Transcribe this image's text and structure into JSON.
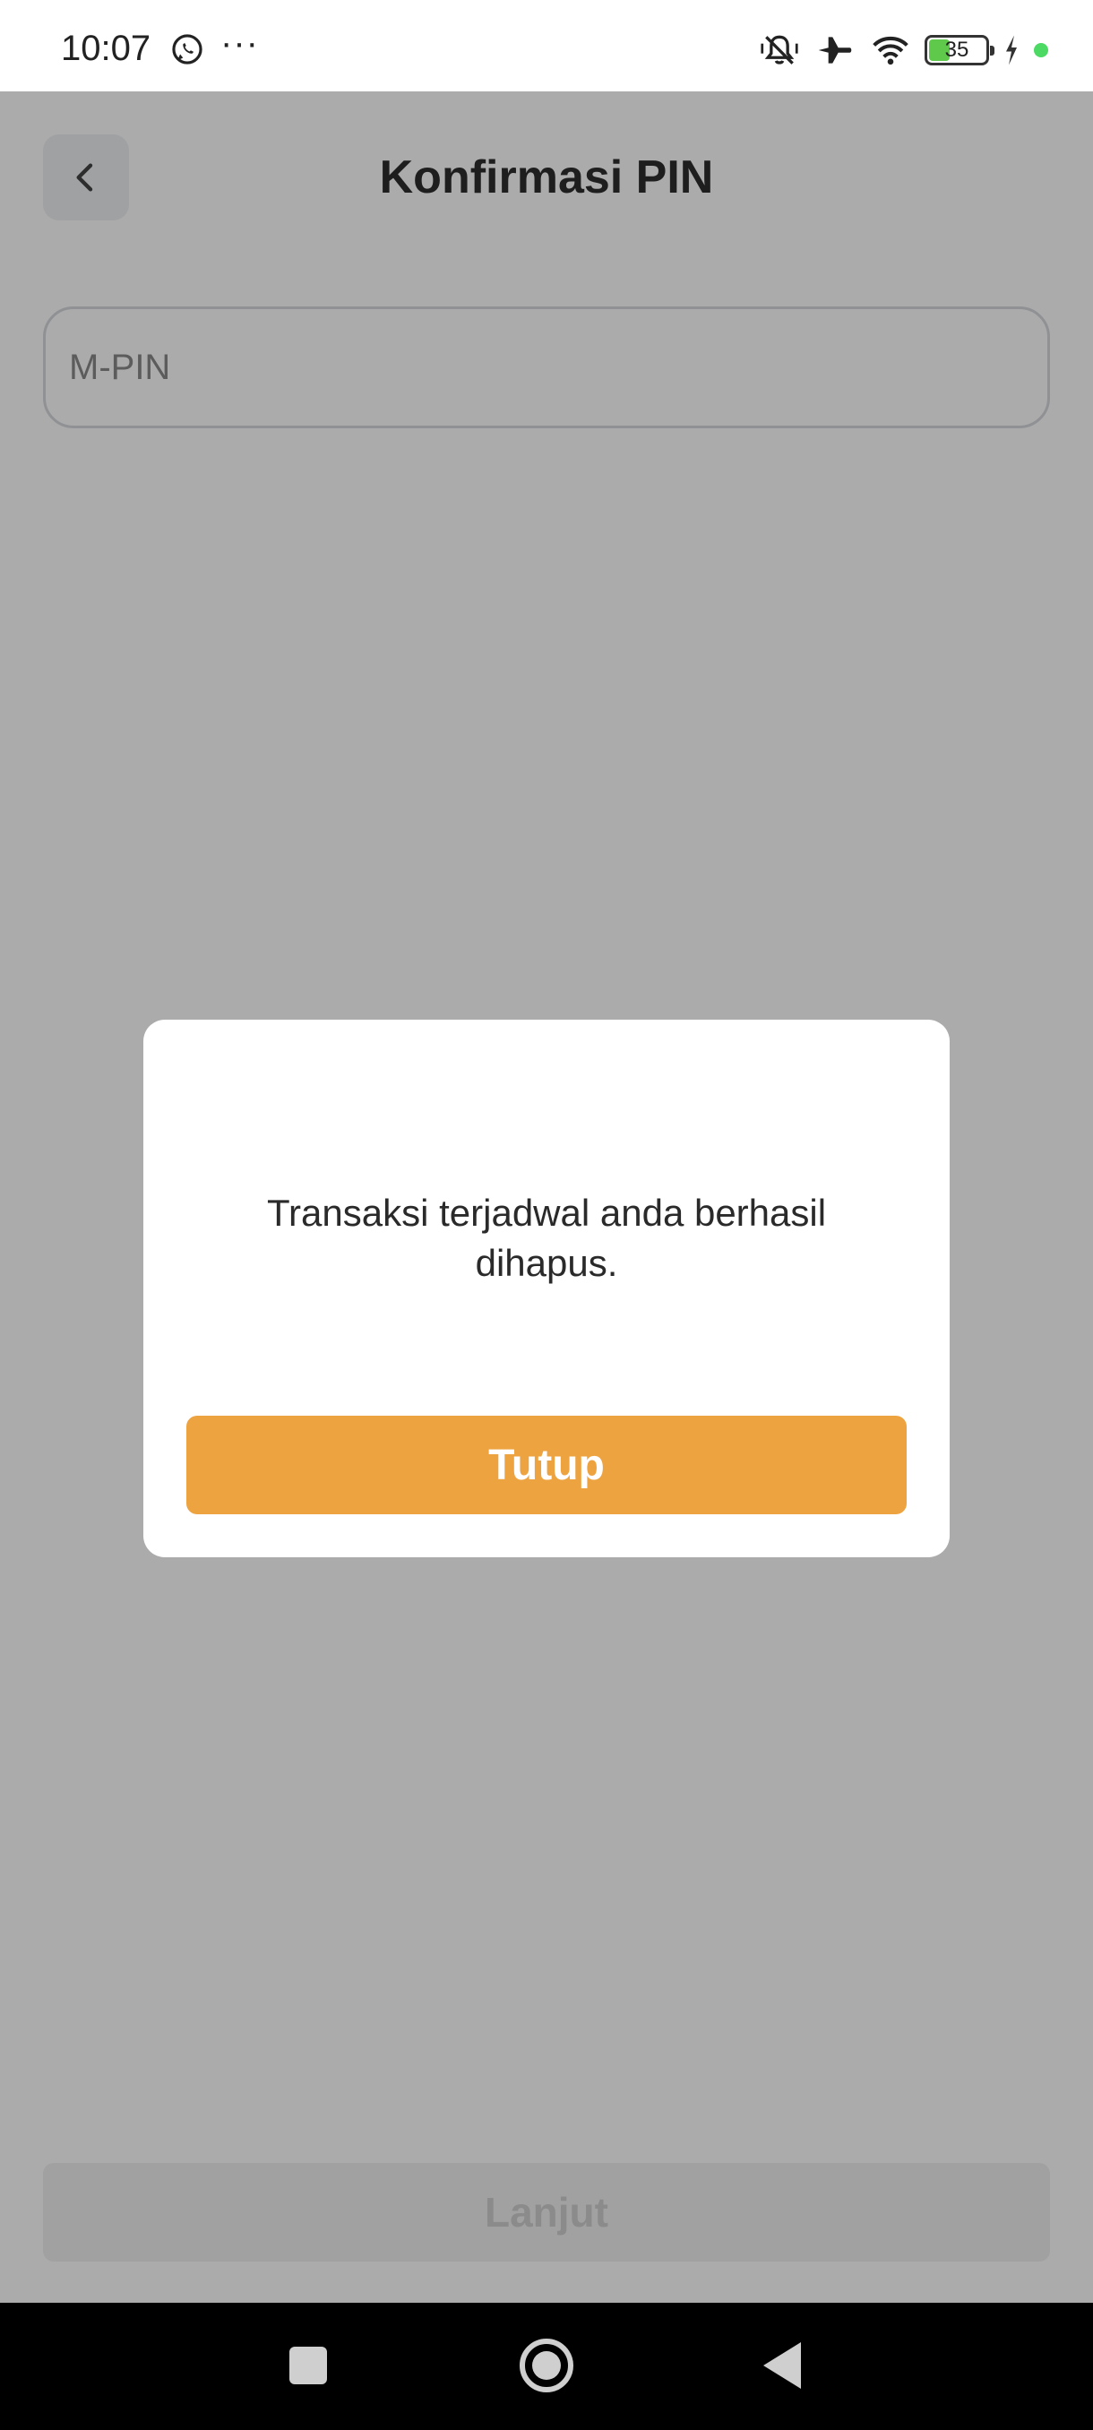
{
  "status_bar": {
    "time": "10:07",
    "more_indicator": "···",
    "battery_percent": "35",
    "battery_level": 0.35,
    "icons": [
      "whatsapp-icon",
      "mute-icon",
      "airplane-icon",
      "wifi-icon",
      "battery-icon",
      "charging-icon"
    ]
  },
  "header": {
    "title": "Konfirmasi PIN",
    "back_icon": "chevron-left-icon"
  },
  "pin_input": {
    "placeholder": "M-PIN",
    "value": ""
  },
  "footer": {
    "continue_label": "Lanjut"
  },
  "dialog": {
    "message": "Transaksi terjadwal anda berhasil dihapus.",
    "close_label": "Tutup"
  },
  "colors": {
    "accent": "#eea341",
    "overlay": "rgba(0,0,0,0.33)"
  }
}
